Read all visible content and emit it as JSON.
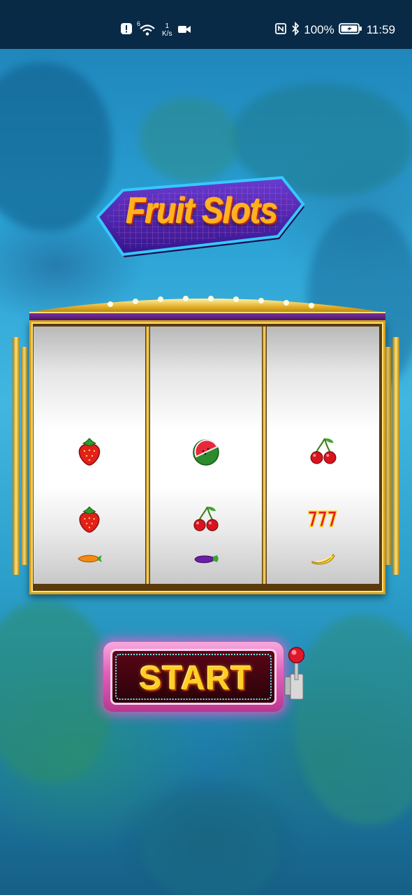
{
  "status_bar": {
    "notification_icon": "alert-icon",
    "wifi_label": "6",
    "net_speed_value": "1",
    "net_speed_unit": "K/s",
    "camera_icon": "video-camera-icon",
    "nfc_icon": "nfc-icon",
    "bluetooth_icon": "bluetooth-icon",
    "battery_percent": "100%",
    "battery_icon": "battery-charging-icon",
    "time": "11:59"
  },
  "game": {
    "title": "Fruit Slots",
    "start_label": "START",
    "reels": [
      {
        "symbols": [
          "strawberry",
          "strawberry",
          "carrot"
        ]
      },
      {
        "symbols": [
          "watermelon",
          "cherry",
          "eggplant"
        ]
      },
      {
        "symbols": [
          "cherry",
          "seven",
          "banana"
        ]
      }
    ]
  },
  "colors": {
    "title_fill": "#ffb21c",
    "banner_purple": "#5a2cb8",
    "banner_border": "#38c8ff",
    "frame_gold": "#d6a21e",
    "start_pink": "#e15fb9",
    "start_text": "#ffcf24",
    "lever_knob": "#e0162b"
  }
}
